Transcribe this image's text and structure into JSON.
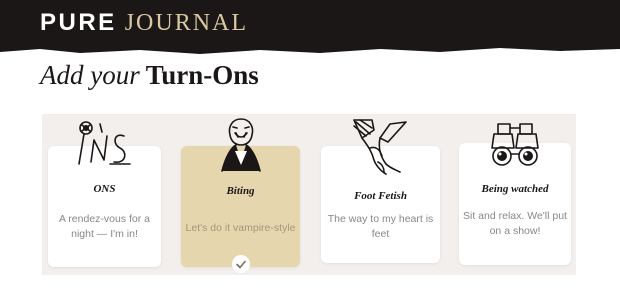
{
  "brand": {
    "word1": "PURE",
    "word2": "JOURNAL"
  },
  "headline": {
    "italic": "Add your",
    "bold": "Turn-Ons"
  },
  "cards": [
    {
      "title": "ONS",
      "description": "A rendez-vous for a night — I'm in!",
      "icon": "ons-lettering-icon",
      "selected": false
    },
    {
      "title": "Biting",
      "description": "Let's do it vampire-style",
      "icon": "vampire-icon",
      "selected": true
    },
    {
      "title": "Foot Fetish",
      "description": "The way to my heart is feet",
      "icon": "feet-icon",
      "selected": false
    },
    {
      "title": "Being watched",
      "description": "Sit and relax. We'll put on a show!",
      "icon": "binoculars-icon",
      "selected": false
    }
  ],
  "colors": {
    "header_bg": "#1a1716",
    "accent_gold": "#d9c8a2",
    "selected_card": "#e6d6ae",
    "panel_bg": "#f2efed"
  }
}
